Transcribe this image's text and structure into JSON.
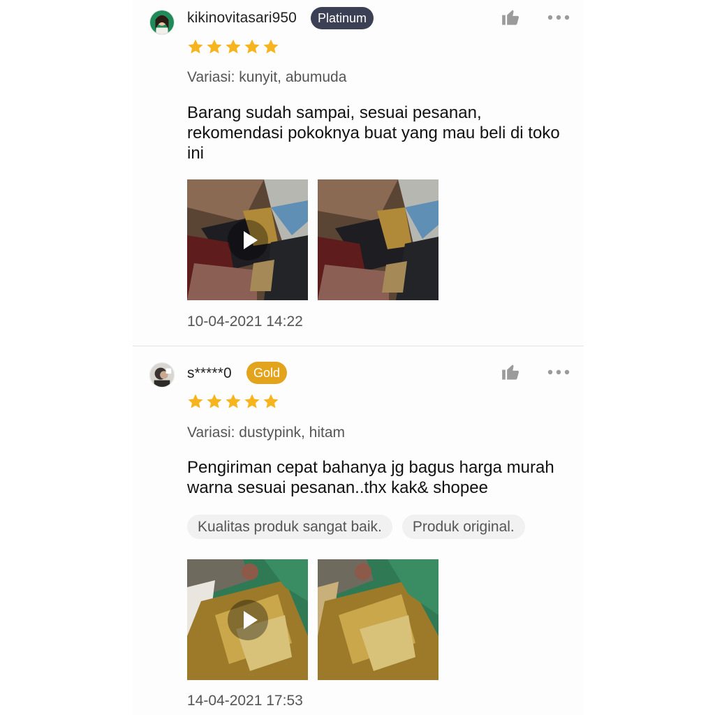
{
  "reviews": [
    {
      "username": "kikinovitasari950",
      "badge": "Platinum",
      "rating": 5,
      "variation": "Variasi: kunyit, abumuda",
      "comment": "Barang sudah sampai, sesuai pesanan, rekomendasi pokoknya buat yang mau beli di toko ini",
      "tags": [],
      "media": [
        {
          "type": "video",
          "icon": "play-icon"
        },
        {
          "type": "image"
        }
      ],
      "timestamp": "10-04-2021 14:22"
    },
    {
      "username": "s*****0",
      "badge": "Gold",
      "rating": 5,
      "variation": "Variasi: dustypink, hitam",
      "comment": "Pengiriman cepat bahanya jg bagus harga murah warna sesuai pesanan..thx kak& shopee",
      "tags": [
        "Kualitas produk sangat baik.",
        "Produk original."
      ],
      "media": [
        {
          "type": "video",
          "icon": "play-icon"
        },
        {
          "type": "image"
        }
      ],
      "timestamp": "14-04-2021 17:53"
    }
  ],
  "colors": {
    "star": "#f6b51e",
    "platinum_badge": "#3c4054",
    "gold_badge": "#e3a41d",
    "icon_gray": "#9b9b9b"
  },
  "icons": {
    "like": "thumbs-up-icon",
    "more": "more-dots-icon",
    "star": "star-icon"
  }
}
